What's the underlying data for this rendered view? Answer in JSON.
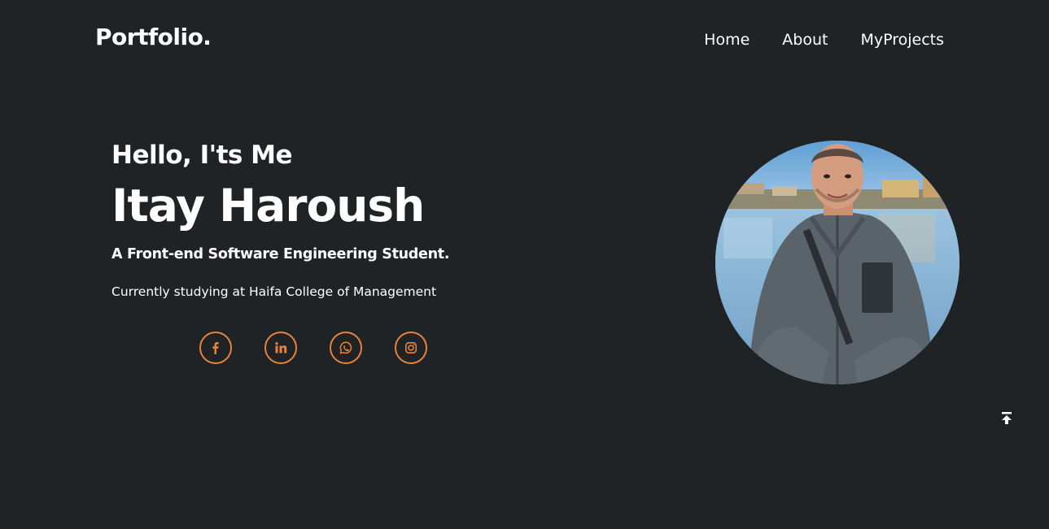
{
  "header": {
    "logo": "Portfolio.",
    "nav": [
      {
        "label": "Home"
      },
      {
        "label": "About"
      },
      {
        "label": "MyProjects"
      }
    ]
  },
  "hero": {
    "greeting": "Hello, I'ts Me",
    "name": "Itay Haroush",
    "role": "A Front-end Software Engineering Student.",
    "study": "Currently studying at Haifa College of Management"
  },
  "socials": [
    {
      "icon": "facebook-icon"
    },
    {
      "icon": "linkedin-icon"
    },
    {
      "icon": "whatsapp-icon"
    },
    {
      "icon": "instagram-icon"
    }
  ],
  "colors": {
    "background": "#1f2326",
    "accent": "#e8833a",
    "text": "#ffffff"
  },
  "back_to_top": {
    "icon": "arrow-up-to-line-icon"
  }
}
